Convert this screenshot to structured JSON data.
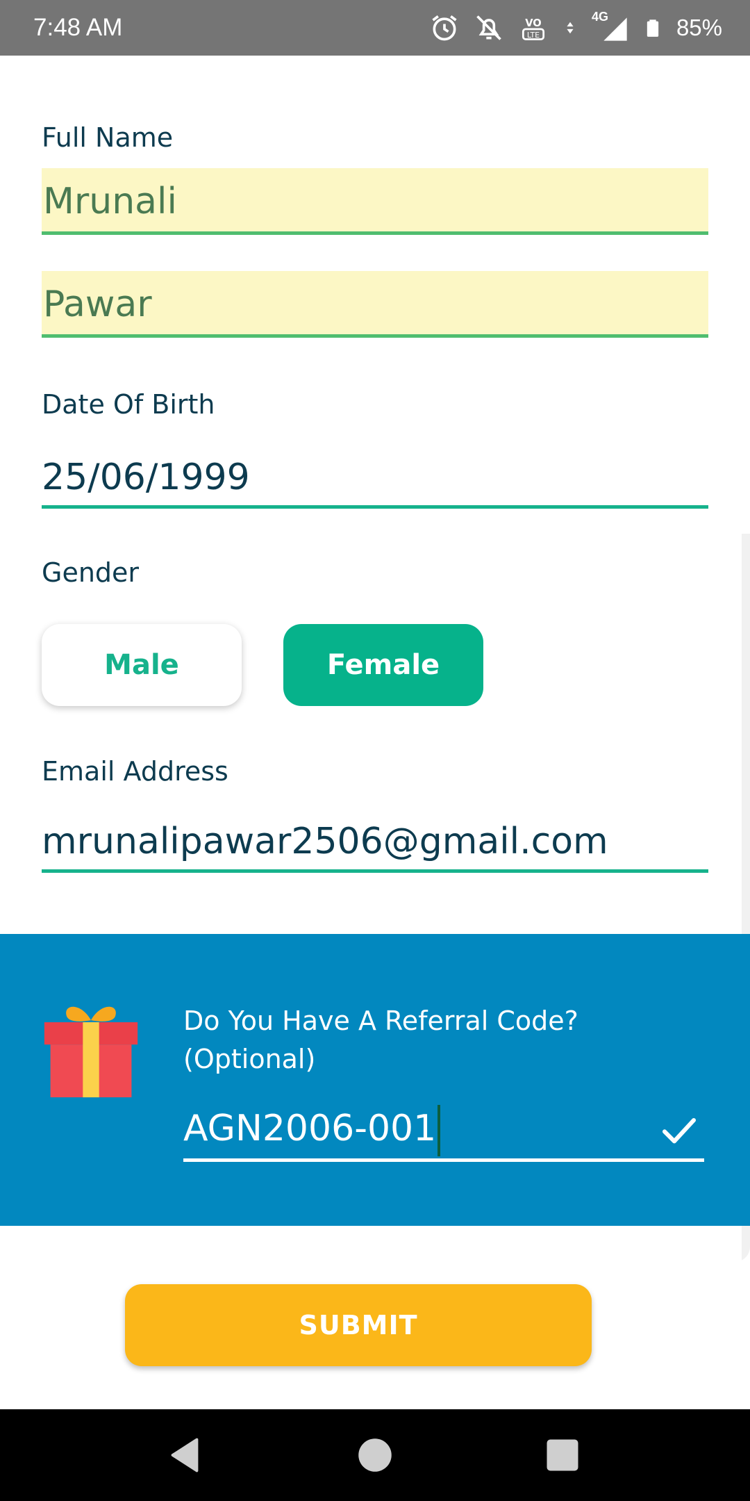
{
  "status_bar": {
    "time": "7:48 AM",
    "network": "4G",
    "battery_percent": "85%",
    "icons": [
      "alarm-icon",
      "notifications-off-icon",
      "volte-icon",
      "data-arrows-icon",
      "signal-icon",
      "battery-icon"
    ]
  },
  "form": {
    "full_name_label": "Full Name",
    "first_name_value": "Mrunali",
    "last_name_value": "Pawar",
    "dob_label": "Date Of Birth",
    "dob_value": "25/06/1999",
    "gender_label": "Gender",
    "gender_options": [
      "Male",
      "Female"
    ],
    "gender_selected": "Female",
    "email_label": "Email Address",
    "email_value": "mrunalipawar2506@gmail.com"
  },
  "referral": {
    "title": "Do You Have A Referral Code? (Optional)",
    "code_value": "AGN2006-001",
    "icon": "gift-icon",
    "confirm_icon": "check-icon"
  },
  "submit_label": "SUBMIT",
  "nav_bar": {
    "icons": [
      "back-icon",
      "home-icon",
      "recents-icon"
    ]
  },
  "colors": {
    "accent_green": "#06b28b",
    "filled_input_bg": "#fcf7c5",
    "referral_bg": "#0288bf",
    "submit_bg": "#fbb719",
    "status_bar_bg": "#757575"
  }
}
